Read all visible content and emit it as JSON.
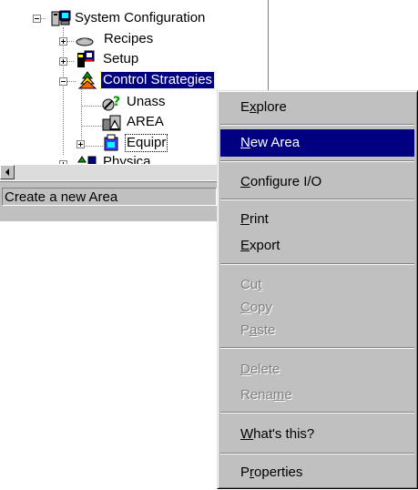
{
  "tree": {
    "items": [
      {
        "label": "System Configuration",
        "icon": "system-config-icon",
        "expander": "minus"
      },
      {
        "label": "Recipes",
        "icon": "recipes-icon",
        "expander": "plus"
      },
      {
        "label": "Setup",
        "icon": "setup-icon",
        "expander": "plus"
      },
      {
        "label": "Control Strategies",
        "icon": "control-strategies-icon",
        "expander": "minus",
        "selected": true
      },
      {
        "label": "Unass",
        "icon": "unassigned-icon"
      },
      {
        "label": "AREA",
        "icon": "area-icon"
      },
      {
        "label": "Equipr",
        "icon": "equipment-icon",
        "expander": "plus"
      },
      {
        "label": "Physica",
        "icon": "physical-network-icon",
        "expander": "plus"
      }
    ]
  },
  "status_bar": {
    "text": "Create a new Area"
  },
  "context_menu": {
    "items": [
      {
        "pre": "E",
        "mn": "x",
        "post": "plore",
        "state": "normal"
      },
      {
        "pre": "",
        "mn": "N",
        "post": "ew Area",
        "state": "highlight"
      },
      {
        "pre": "",
        "mn": "C",
        "post": "onfigure I/O",
        "state": "normal"
      },
      {
        "pre": "",
        "mn": "P",
        "post": "rint",
        "state": "normal"
      },
      {
        "pre": "",
        "mn": "E",
        "post": "xport",
        "state": "normal"
      },
      {
        "pre": "Cu",
        "mn": "t",
        "post": "",
        "state": "disabled"
      },
      {
        "pre": "",
        "mn": "C",
        "post": "opy",
        "state": "disabled"
      },
      {
        "pre": "P",
        "mn": "a",
        "post": "ste",
        "state": "disabled"
      },
      {
        "pre": "",
        "mn": "D",
        "post": "elete",
        "state": "disabled"
      },
      {
        "pre": "Rena",
        "mn": "m",
        "post": "e",
        "state": "disabled"
      },
      {
        "pre": "",
        "mn": "W",
        "post": "hat's this?",
        "state": "normal"
      },
      {
        "pre": "P",
        "mn": "r",
        "post": "operties",
        "state": "normal"
      }
    ]
  },
  "colors": {
    "highlight": "#000080",
    "menu_bg": "#c0c0c0",
    "disabled_text": "#808080"
  }
}
